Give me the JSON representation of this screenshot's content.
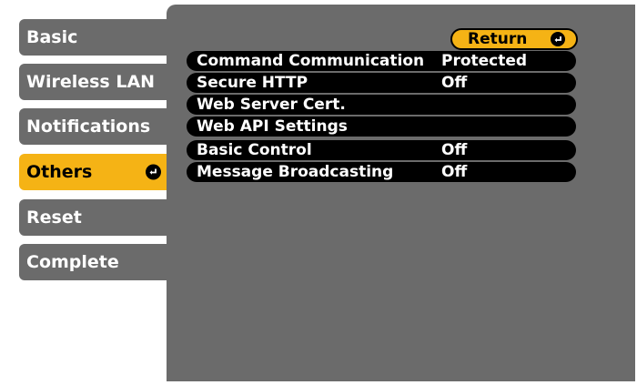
{
  "menu": {
    "items": [
      {
        "label": "Basic"
      },
      {
        "label": "Wireless LAN"
      },
      {
        "label": "Notifications"
      },
      {
        "label": "Others",
        "selected": true
      },
      {
        "label": "Reset"
      },
      {
        "label": "Complete"
      }
    ],
    "enter_icon": "enter-icon"
  },
  "panel": {
    "return_label": "Return",
    "rows": [
      {
        "label": "Command Communication",
        "value": "Protected"
      },
      {
        "label": "Secure HTTP",
        "value": "Off"
      },
      {
        "label": "Web Server Cert.",
        "value": ""
      },
      {
        "label": "Web API Settings",
        "value": ""
      },
      {
        "label": "Basic Control",
        "value": "Off"
      },
      {
        "label": "Message Broadcasting",
        "value": "Off"
      }
    ]
  },
  "colors": {
    "panel_gray": "#6b6b6b",
    "accent_yellow": "#f5b315",
    "row_black": "#000000"
  }
}
